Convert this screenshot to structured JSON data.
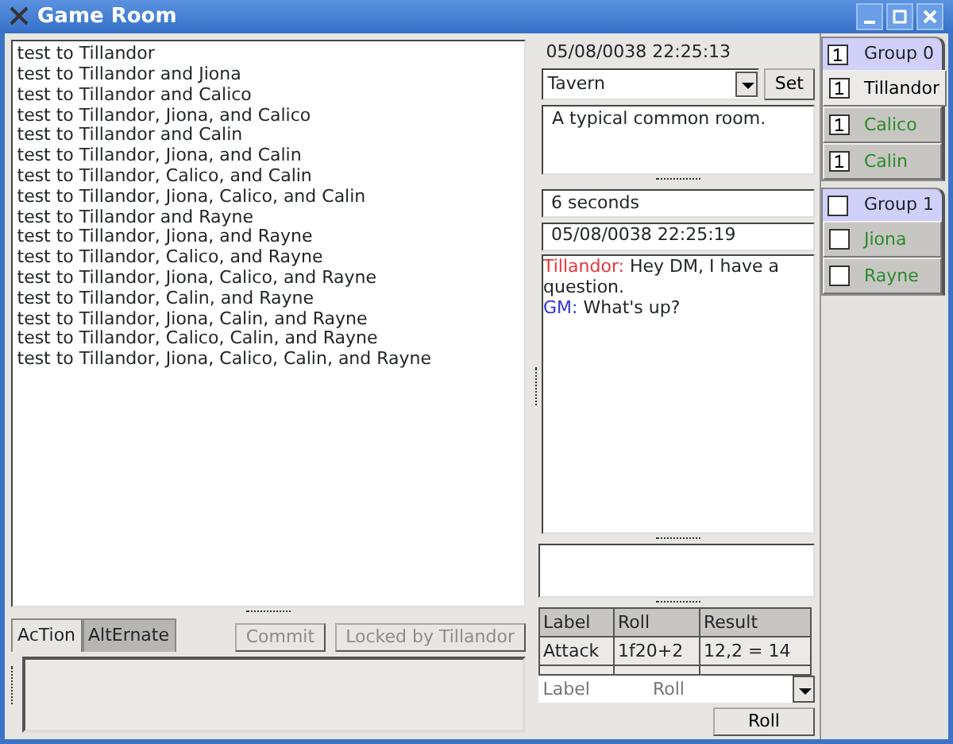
{
  "window": {
    "title": "Game Room"
  },
  "log": [
    "test to Tillandor",
    "test to Tillandor and Jiona",
    "test to Tillandor and Calico",
    "test to Tillandor, Jiona, and Calico",
    "test to Tillandor and Calin",
    "test to Tillandor, Jiona, and Calin",
    "test to Tillandor, Calico, and Calin",
    "test to Tillandor, Jiona, Calico, and Calin",
    "test to Tillandor and Rayne",
    "test to Tillandor, Jiona, and Rayne",
    "test to Tillandor, Calico, and Rayne",
    "test to Tillandor, Jiona, Calico, and Rayne",
    "test to Tillandor, Calin, and Rayne",
    "test to Tillandor, Jiona, Calin, and Rayne",
    "test to Tillandor, Calico, Calin, and Rayne",
    "test to Tillandor, Jiona, Calico, Calin, and Rayne"
  ],
  "tabs": [
    {
      "label": "AcTion",
      "selected": true
    },
    {
      "label": "AltErnate",
      "selected": false
    }
  ],
  "buttons": [
    {
      "label": "Commit",
      "disabled": true
    },
    {
      "label": "Locked by Tillandor",
      "disabled": true
    }
  ],
  "room": {
    "timestamp": "05/08/0038 22:25:13",
    "location": "Tavern",
    "set_button": "Set",
    "description": "A typical common room."
  },
  "elapsed": "6 seconds",
  "chat_timestamp": "05/08/0038 22:25:19",
  "chat": [
    {
      "speaker": "Tillandor:",
      "color": "#e8363a",
      "text": "Hey DM, I have a question."
    },
    {
      "speaker": "GM:",
      "color": "#3333dd",
      "text": "What's up?"
    }
  ],
  "rolls": {
    "columns": [
      "Label",
      "Roll",
      "Result"
    ],
    "rows": [
      [
        "Attack",
        "1f20+2",
        "12,2 = 14"
      ]
    ],
    "label_placeholder": "Label",
    "roll_placeholder": "Roll",
    "roll_button": "Roll"
  },
  "groups": [
    {
      "name": "Group 0",
      "checked": true,
      "members": [
        {
          "name": "Tillandor",
          "checked": true,
          "selected": true,
          "color": "#000000"
        },
        {
          "name": "Calico",
          "checked": true,
          "selected": false,
          "color": "#2a8a2a"
        },
        {
          "name": "Calin",
          "checked": true,
          "selected": false,
          "color": "#2a8a2a"
        }
      ]
    },
    {
      "name": "Group 1",
      "checked": false,
      "members": [
        {
          "name": "Jiona",
          "checked": false,
          "selected": false,
          "color": "#2a8a2a"
        },
        {
          "name": "Rayne",
          "checked": false,
          "selected": false,
          "color": "#2a8a2a"
        }
      ]
    }
  ]
}
